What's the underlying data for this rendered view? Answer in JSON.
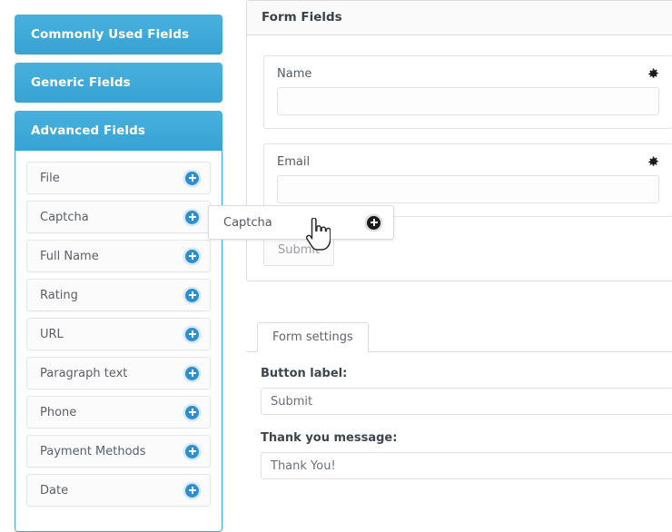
{
  "sidebar": {
    "groups": [
      {
        "label": "Commonly Used Fields",
        "open": false
      },
      {
        "label": "Generic Fields",
        "open": false
      },
      {
        "label": "Advanced Fields",
        "open": true
      }
    ],
    "advanced_fields": [
      {
        "label": "File",
        "icon": "plus-circle-icon"
      },
      {
        "label": "Captcha",
        "icon": "plus-circle-icon"
      },
      {
        "label": "Full Name",
        "icon": "plus-circle-icon"
      },
      {
        "label": "Rating",
        "icon": "plus-circle-icon"
      },
      {
        "label": "URL",
        "icon": "plus-circle-icon"
      },
      {
        "label": "Paragraph text",
        "icon": "plus-circle-icon"
      },
      {
        "label": "Phone",
        "icon": "plus-circle-icon"
      },
      {
        "label": "Payment Methods",
        "icon": "plus-circle-icon"
      },
      {
        "label": "Date",
        "icon": "plus-circle-icon"
      }
    ]
  },
  "drag": {
    "label": "Captcha",
    "icon": "plus-circle-icon",
    "cursor": "pointer-hand-cursor"
  },
  "form_fields_panel": {
    "title": "Form Fields",
    "fields": [
      {
        "label": "Name",
        "value": "",
        "settings_icon": "gear-icon"
      },
      {
        "label": "Email",
        "value": "",
        "settings_icon": "gear-icon"
      }
    ],
    "submit_label": "Submit"
  },
  "form_settings": {
    "tabs": [
      {
        "label": "Form settings",
        "active": true
      }
    ],
    "button_label_caption": "Button label:",
    "button_label_value": "Submit",
    "thank_you_caption": "Thank you message:",
    "thank_you_value": "Thank You!"
  },
  "colors": {
    "accent_blue": "#3ba8d8",
    "plus_blue": "#2b8fd4",
    "border_grey": "#dddddd"
  }
}
